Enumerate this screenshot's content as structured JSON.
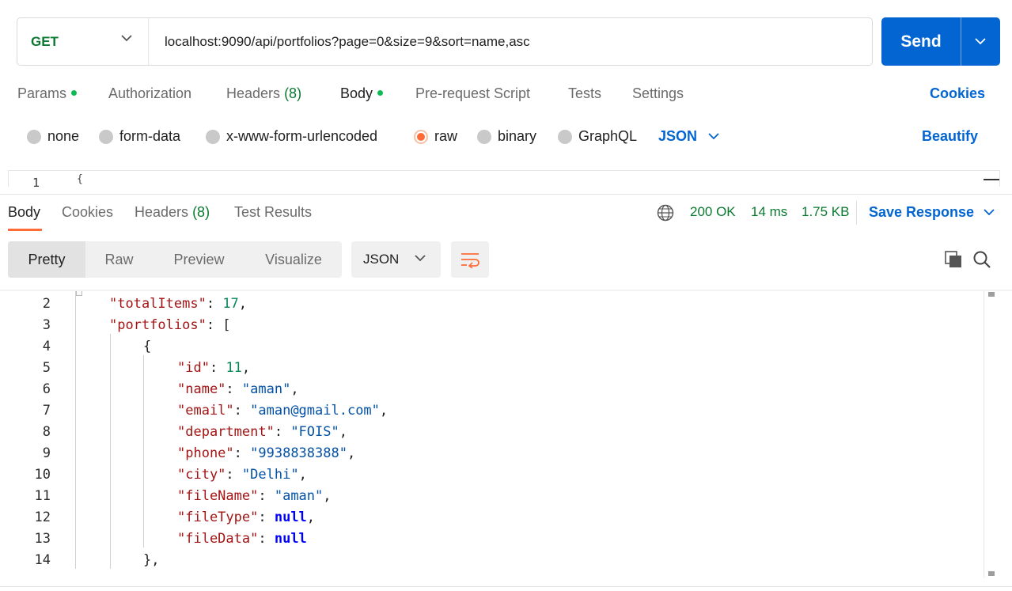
{
  "request": {
    "method": "GET",
    "url": "localhost:9090/api/portfolios?page=0&size=9&sort=name,asc",
    "send_label": "Send"
  },
  "request_tabs": {
    "params": "Params",
    "authorization": "Authorization",
    "headers": "Headers",
    "headers_count": "(8)",
    "body": "Body",
    "prerequest": "Pre-request Script",
    "tests": "Tests",
    "settings": "Settings",
    "cookies": "Cookies"
  },
  "body_types": {
    "none": "none",
    "form_data": "form-data",
    "urlencoded": "x-www-form-urlencoded",
    "raw": "raw",
    "binary": "binary",
    "graphql": "GraphQL",
    "format": "JSON",
    "beautify": "Beautify",
    "selected": "raw"
  },
  "request_editor": {
    "line_number": "1",
    "first_char": "{"
  },
  "response_tabs": {
    "body": "Body",
    "cookies": "Cookies",
    "headers": "Headers",
    "headers_count": "(8)",
    "test_results": "Test Results"
  },
  "response_status": {
    "status": "200 OK",
    "time": "14 ms",
    "size": "1.75 KB",
    "save_response": "Save Response"
  },
  "view_modes": {
    "pretty": "Pretty",
    "raw": "Raw",
    "preview": "Preview",
    "visualize": "Visualize",
    "format": "JSON"
  },
  "response_lines": [
    {
      "n": "2",
      "indent": 1,
      "tokens": [
        [
          "k",
          "\"totalItems\""
        ],
        [
          "p",
          ": "
        ],
        [
          "n",
          "17"
        ],
        [
          "p",
          ","
        ]
      ]
    },
    {
      "n": "3",
      "indent": 1,
      "tokens": [
        [
          "k",
          "\"portfolios\""
        ],
        [
          "p",
          ": ["
        ]
      ]
    },
    {
      "n": "4",
      "indent": 2,
      "tokens": [
        [
          "p",
          "{"
        ]
      ]
    },
    {
      "n": "5",
      "indent": 3,
      "tokens": [
        [
          "k",
          "\"id\""
        ],
        [
          "p",
          ": "
        ],
        [
          "n",
          "11"
        ],
        [
          "p",
          ","
        ]
      ]
    },
    {
      "n": "6",
      "indent": 3,
      "tokens": [
        [
          "k",
          "\"name\""
        ],
        [
          "p",
          ": "
        ],
        [
          "s",
          "\"aman\""
        ],
        [
          "p",
          ","
        ]
      ]
    },
    {
      "n": "7",
      "indent": 3,
      "tokens": [
        [
          "k",
          "\"email\""
        ],
        [
          "p",
          ": "
        ],
        [
          "s",
          "\"aman@gmail.com\""
        ],
        [
          "p",
          ","
        ]
      ]
    },
    {
      "n": "8",
      "indent": 3,
      "tokens": [
        [
          "k",
          "\"department\""
        ],
        [
          "p",
          ": "
        ],
        [
          "s",
          "\"FOIS\""
        ],
        [
          "p",
          ","
        ]
      ]
    },
    {
      "n": "9",
      "indent": 3,
      "tokens": [
        [
          "k",
          "\"phone\""
        ],
        [
          "p",
          ": "
        ],
        [
          "s",
          "\"9938838388\""
        ],
        [
          "p",
          ","
        ]
      ]
    },
    {
      "n": "10",
      "indent": 3,
      "tokens": [
        [
          "k",
          "\"city\""
        ],
        [
          "p",
          ": "
        ],
        [
          "s",
          "\"Delhi\""
        ],
        [
          "p",
          ","
        ]
      ]
    },
    {
      "n": "11",
      "indent": 3,
      "tokens": [
        [
          "k",
          "\"fileName\""
        ],
        [
          "p",
          ": "
        ],
        [
          "s",
          "\"aman\""
        ],
        [
          "p",
          ","
        ]
      ]
    },
    {
      "n": "12",
      "indent": 3,
      "tokens": [
        [
          "k",
          "\"fileType\""
        ],
        [
          "p",
          ": "
        ],
        [
          "kw",
          "null"
        ],
        [
          "p",
          ","
        ]
      ]
    },
    {
      "n": "13",
      "indent": 3,
      "tokens": [
        [
          "k",
          "\"fileData\""
        ],
        [
          "p",
          ": "
        ],
        [
          "kw",
          "null"
        ]
      ]
    },
    {
      "n": "14",
      "indent": 2,
      "tokens": [
        [
          "p",
          "},"
        ]
      ]
    }
  ],
  "colors": {
    "accent_blue": "#0265d2",
    "status_green": "#0b7a31",
    "active_orange": "#ff6c37"
  }
}
